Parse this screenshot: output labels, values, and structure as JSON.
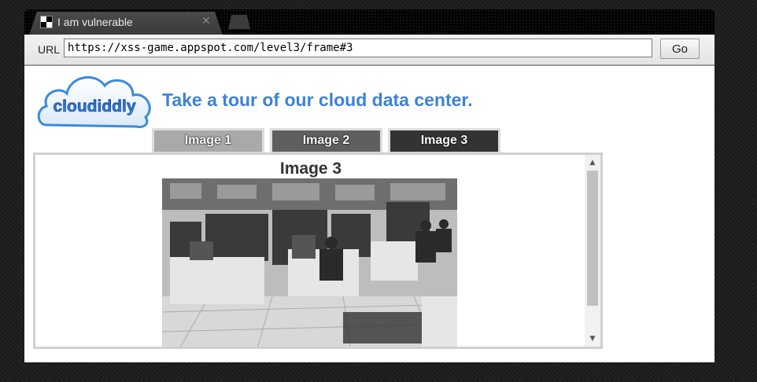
{
  "browser": {
    "tab_title": "I am vulnerable",
    "tab_close": "✕",
    "url_label": "URL",
    "url": "https://xss-game.appspot.com/level3/frame#3",
    "go_label": "Go"
  },
  "page": {
    "logo_text": "cloudiddly",
    "headline": "Take a tour of our cloud data center.",
    "tabs": [
      {
        "label": "Image 1",
        "color": "#a9a9a9"
      },
      {
        "label": "Image 2",
        "color": "#5f5f5f"
      },
      {
        "label": "Image 3",
        "color": "#333333"
      }
    ],
    "selected_image_title": "Image 3"
  },
  "icons": {
    "scroll_up": "▲",
    "scroll_down": "▼"
  }
}
